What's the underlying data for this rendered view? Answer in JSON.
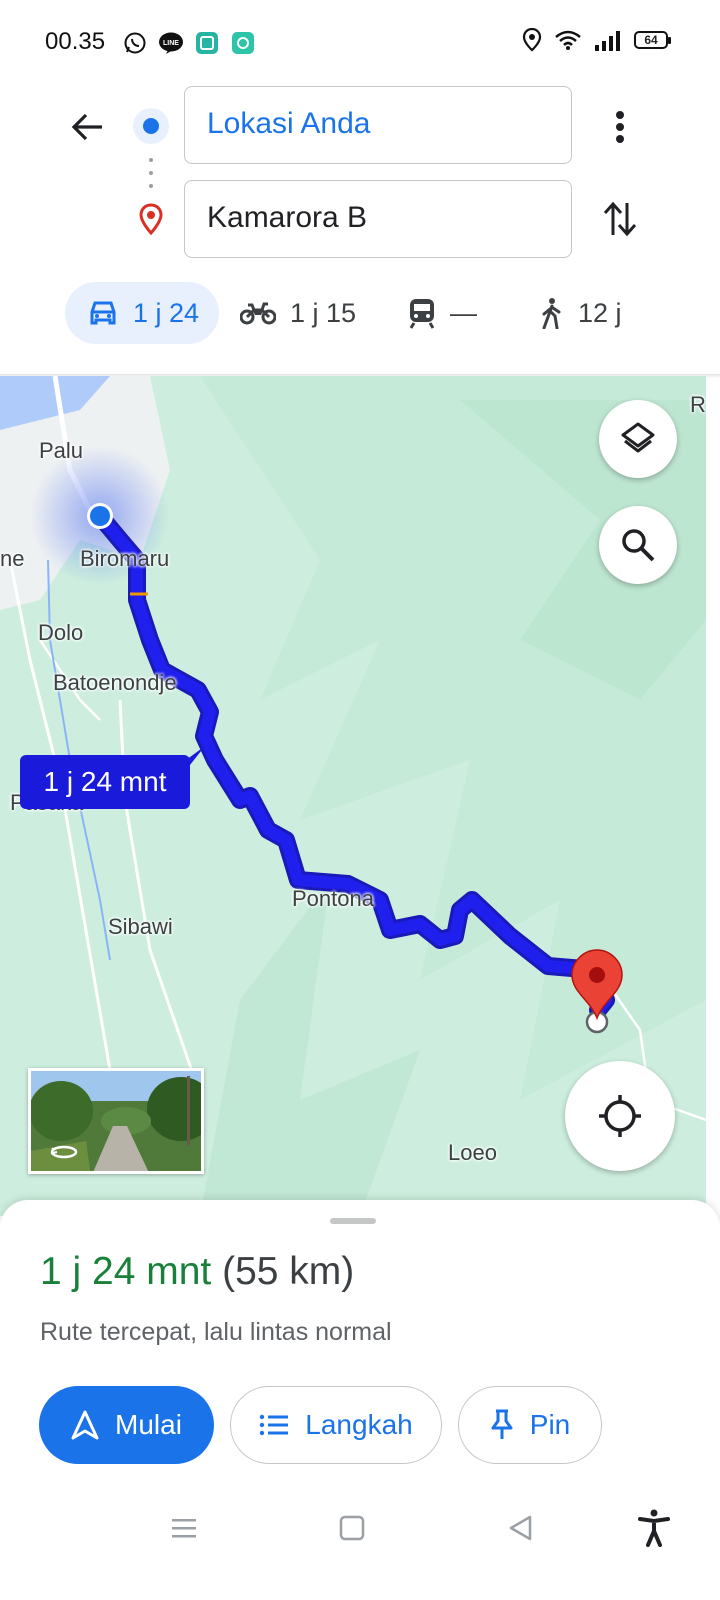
{
  "status_bar": {
    "time": "00.35",
    "battery": "64",
    "icons_left": [
      "whatsapp-icon",
      "line-icon",
      "app-icon",
      "app-icon-2"
    ],
    "icons_right": [
      "location-icon",
      "wifi-icon",
      "signal-icon",
      "battery-icon"
    ]
  },
  "directions": {
    "origin": "Lokasi Anda",
    "destination": "Kamarora B"
  },
  "modes": [
    {
      "name": "car-icon",
      "label": "1 j 24",
      "active": true
    },
    {
      "name": "motorcycle-icon",
      "label": "1 j 15",
      "active": false
    },
    {
      "name": "transit-icon",
      "label": "—",
      "active": false
    },
    {
      "name": "walk-icon",
      "label": "12 j",
      "active": false
    }
  ],
  "map": {
    "labels": {
      "palu": "Palu",
      "biromaru": "Biromaru",
      "ne": "ne",
      "dolo": "Dolo",
      "batoenondje": "Batoenondje",
      "pasaka": "Pasaka",
      "sibawi": "Sibawi",
      "pontona": "Pontona",
      "loeo": "Loeo",
      "r": "R"
    },
    "duration_chip": "1 j 24 mnt",
    "route_color": "#1a1af0"
  },
  "sheet": {
    "time": "1 j 24 mnt",
    "distance": "(55 km)",
    "description": "Rute tercepat, lalu lintas normal",
    "start_label": "Mulai",
    "steps_label": "Langkah",
    "pin_label": "Pin"
  },
  "colors": {
    "accent": "#1a73e8",
    "time_green": "#188038",
    "map_green": "#cdeede",
    "pin_red": "#d93025"
  }
}
